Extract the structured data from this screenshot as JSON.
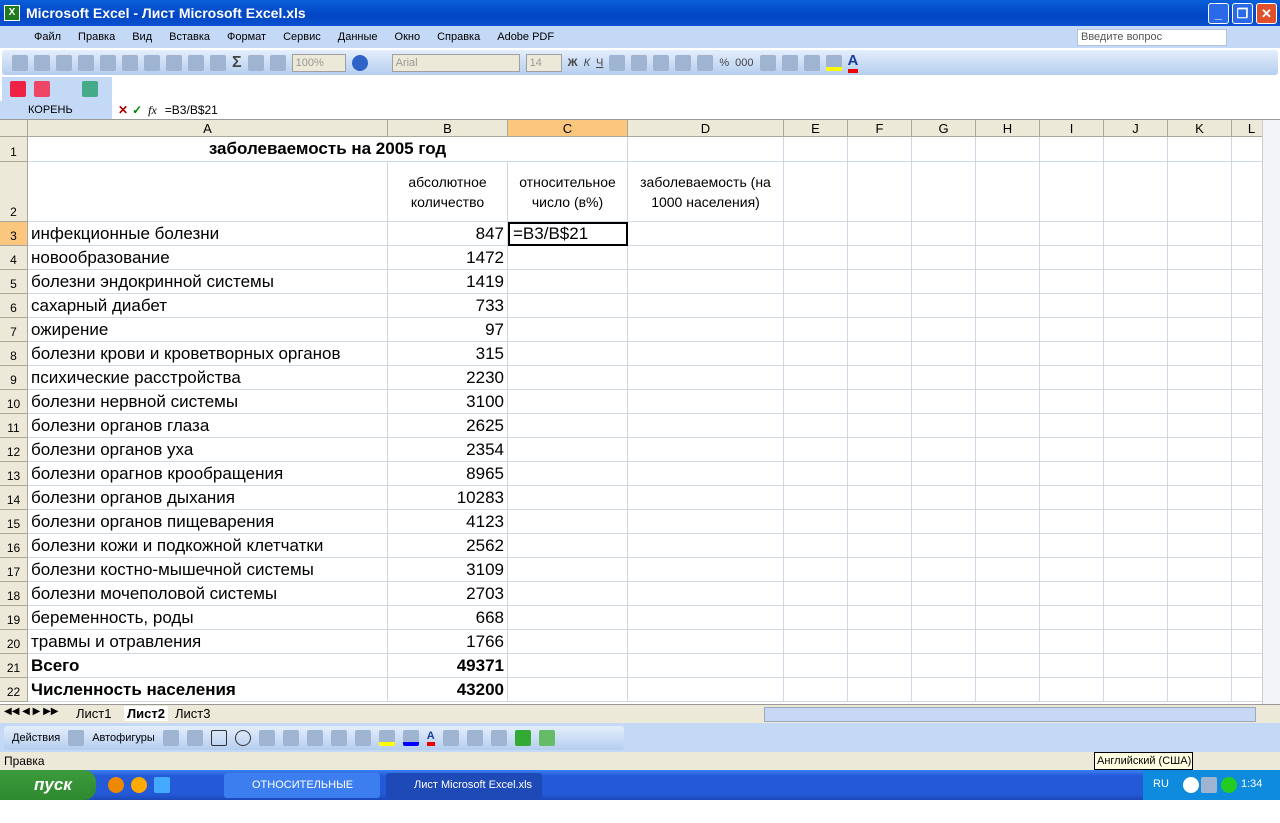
{
  "window": {
    "title": "Microsoft Excel - Лист Microsoft Excel.xls"
  },
  "menu": [
    "Файл",
    "Правка",
    "Вид",
    "Вставка",
    "Формат",
    "Сервис",
    "Данные",
    "Окно",
    "Справка",
    "Adobe PDF"
  ],
  "ask_placeholder": "Введите вопрос",
  "toolbar": {
    "zoom": "100%",
    "font": "Arial",
    "size": "14",
    "bold": "Ж",
    "italic": "К",
    "underline": "Ч",
    "percent": "%",
    "thousands": "000"
  },
  "formula_bar": {
    "name_box": "КОРЕНЬ",
    "formula": "=B3/B$21"
  },
  "columns": [
    "A",
    "B",
    "C",
    "D",
    "E",
    "F",
    "G",
    "H",
    "I",
    "J",
    "K",
    "L"
  ],
  "rows": [
    {
      "n": "1",
      "a": "заболеваемость на 2005 год"
    },
    {
      "n": "2",
      "b": "абсолютное количество",
      "c": "относительное число (в%)",
      "d": "заболеваемость (на 1000 населения)"
    },
    {
      "n": "3",
      "a": "инфекционные болезни",
      "b": "847",
      "c": "=B3/B$21"
    },
    {
      "n": "4",
      "a": "новообразование",
      "b": "1472"
    },
    {
      "n": "5",
      "a": "болезни эндокринной системы",
      "b": "1419"
    },
    {
      "n": "6",
      "a": "сахарный диабет",
      "b": "733"
    },
    {
      "n": "7",
      "a": "ожирение",
      "b": "97"
    },
    {
      "n": "8",
      "a": "болезни крови и кроветворных органов",
      "b": "315"
    },
    {
      "n": "9",
      "a": "психические расстройства",
      "b": "2230"
    },
    {
      "n": "10",
      "a": "болезни нервной системы",
      "b": "3100"
    },
    {
      "n": "11",
      "a": "болезни органов глаза",
      "b": "2625"
    },
    {
      "n": "12",
      "a": "болезни органов уха",
      "b": "2354"
    },
    {
      "n": "13",
      "a": "болезни орагнов крообращения",
      "b": "8965"
    },
    {
      "n": "14",
      "a": "болезни органов дыхания",
      "b": "10283"
    },
    {
      "n": "15",
      "a": "болезни органов пищеварения",
      "b": "4123"
    },
    {
      "n": "16",
      "a": "болезни кожи и подкожной клетчатки",
      "b": "2562"
    },
    {
      "n": "17",
      "a": "болезни костно-мышечной системы",
      "b": "3109"
    },
    {
      "n": "18",
      "a": "болезни мочеполовой системы",
      "b": "2703"
    },
    {
      "n": "19",
      "a": "беременность, роды",
      "b": "668"
    },
    {
      "n": "20",
      "a": "травмы и отравления",
      "b": "1766"
    },
    {
      "n": "21",
      "a": "Всего",
      "b": "49371",
      "bold": true
    },
    {
      "n": "22",
      "a": "Численность населения",
      "b": "43200",
      "bold": true
    }
  ],
  "sheets": [
    "Лист1",
    "Лист2",
    "Лист3"
  ],
  "draw": {
    "actions": "Действия",
    "autoshapes": "Автофигуры"
  },
  "status": "Правка",
  "tooltip": "Английский (США)",
  "taskbar": {
    "start": "пуск",
    "items": [
      "ОТНОСИТЕЛЬНЫЕ ВЕ...",
      "Лист Microsoft Excel.xls"
    ],
    "lang": "RU",
    "time": "1:34"
  }
}
